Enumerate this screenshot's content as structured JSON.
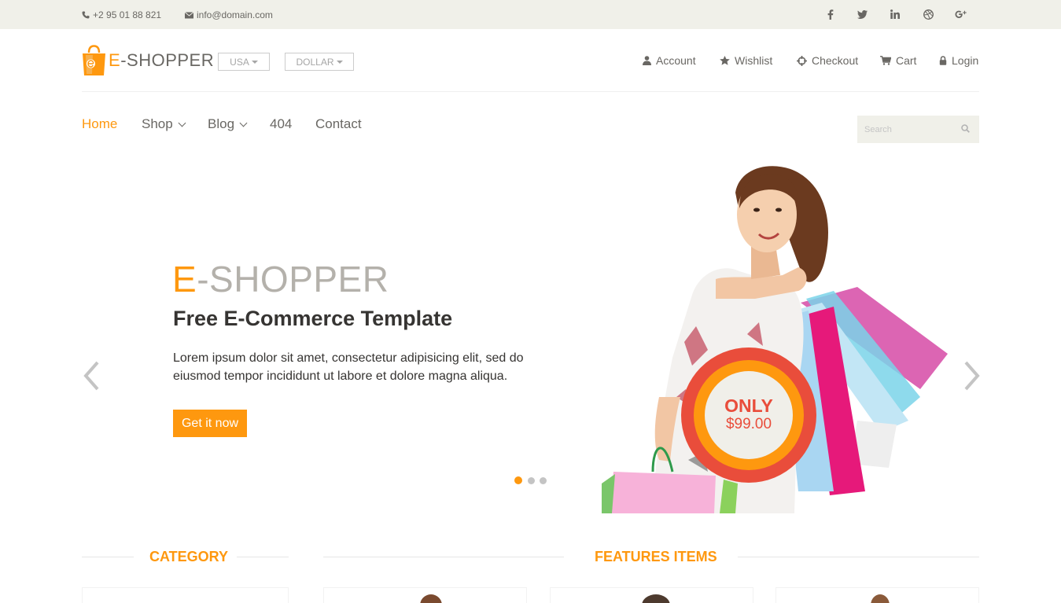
{
  "topbar": {
    "phone": "+2 95 01 88 821",
    "email": "info@domain.com",
    "social": [
      "facebook-icon",
      "twitter-icon",
      "linkedin-icon",
      "dribbble-icon",
      "google-plus-icon"
    ]
  },
  "header": {
    "logo_e": "E",
    "logo_rest": "-SHOPPER",
    "country_label": "USA",
    "currency_label": "DOLLAR",
    "account_links": [
      {
        "label": "Account",
        "icon": "user-icon"
      },
      {
        "label": "Wishlist",
        "icon": "star-icon"
      },
      {
        "label": "Checkout",
        "icon": "crosshairs-icon"
      },
      {
        "label": "Cart",
        "icon": "cart-icon"
      },
      {
        "label": "Login",
        "icon": "lock-icon"
      }
    ]
  },
  "nav": {
    "items": [
      {
        "label": "Home",
        "active": true
      },
      {
        "label": "Shop",
        "dropdown": true
      },
      {
        "label": "Blog",
        "dropdown": true
      },
      {
        "label": "404"
      },
      {
        "label": "Contact"
      }
    ],
    "search_placeholder": "Search"
  },
  "slider": {
    "title_e": "E",
    "title_rest": "-SHOPPER",
    "subtitle": "Free E-Commerce Template",
    "description": "Lorem ipsum dolor sit amet, consectetur adipisicing elit, sed do eiusmod tempor incididunt ut labore et dolore magna aliqua.",
    "button": "Get it now",
    "badge_top": "ONLY",
    "badge_price": "$99.00",
    "active_slide": 1,
    "slide_count": 3
  },
  "sections": {
    "category": "CATEGORY",
    "features": "FEATURES ITEMS"
  },
  "colors": {
    "accent": "#fe980f",
    "text": "#696763",
    "dark": "#363432",
    "topbar_bg": "#f0f0e9",
    "badge_red": "#e94d3b"
  }
}
